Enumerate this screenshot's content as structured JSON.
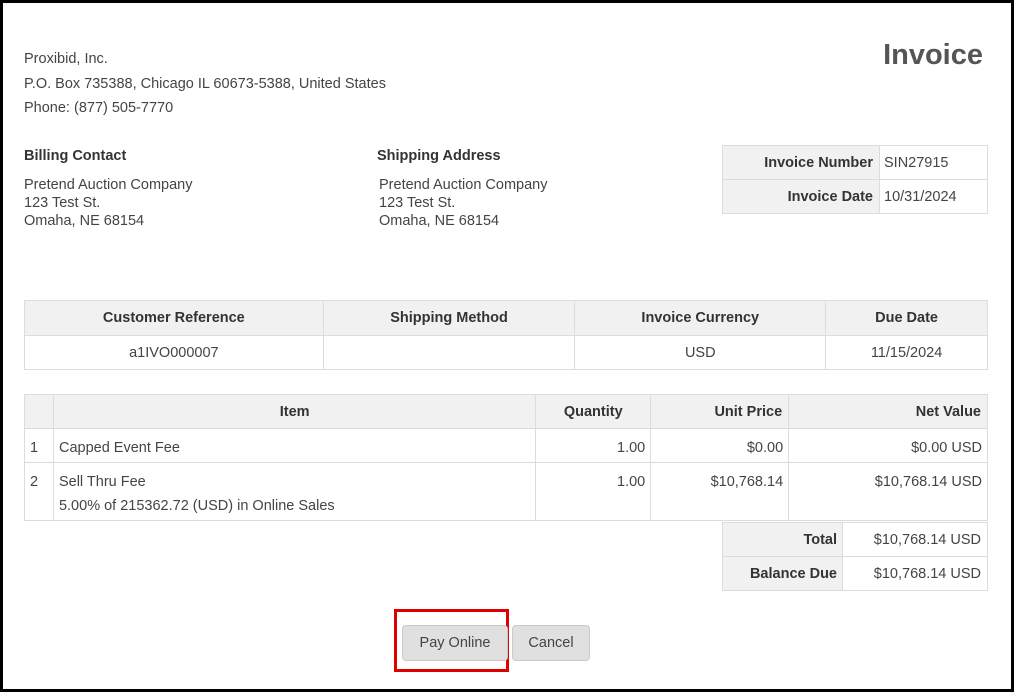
{
  "company": {
    "name": "Proxibid, Inc.",
    "address": "P.O. Box 735388, Chicago IL 60673-5388, United States",
    "phone": "Phone: (877) 505-7770"
  },
  "document_title": "Invoice",
  "billing": {
    "label": "Billing Contact",
    "lines": [
      "Pretend Auction Company",
      "123 Test St.",
      "Omaha, NE 68154"
    ]
  },
  "shipping": {
    "label": "Shipping Address",
    "lines": [
      "Pretend Auction Company",
      "123 Test St.",
      "Omaha, NE 68154"
    ]
  },
  "invoice_meta": [
    {
      "label": "Invoice Number",
      "value": "SIN27915"
    },
    {
      "label": "Invoice Date",
      "value": "10/31/2024"
    }
  ],
  "reference_table": {
    "headers": [
      "Customer Reference",
      "Shipping Method",
      "Invoice Currency",
      "Due Date"
    ],
    "row": [
      "a1IVO000007",
      "",
      "USD",
      "11/15/2024"
    ]
  },
  "items_table": {
    "headers": [
      "",
      "Item",
      "Quantity",
      "Unit Price",
      "Net Value"
    ],
    "rows": [
      {
        "index": "1",
        "item": "Capped Event Fee",
        "detail": "",
        "quantity": "1.00",
        "unit_price": "$0.00",
        "net_value": "$0.00 USD"
      },
      {
        "index": "2",
        "item": "Sell Thru Fee",
        "detail": "5.00% of 215362.72 (USD) in Online Sales",
        "quantity": "1.00",
        "unit_price": "$10,768.14",
        "net_value": "$10,768.14 USD"
      }
    ]
  },
  "totals": [
    {
      "label": "Total",
      "value": "$10,768.14 USD"
    },
    {
      "label": "Balance Due",
      "value": "$10,768.14 USD"
    }
  ],
  "buttons": {
    "pay_online": "Pay Online",
    "cancel": "Cancel"
  },
  "colors": {
    "highlight_border": "#e00000",
    "header_bg": "#f1f1f1",
    "button_bg": "#e0e0e0"
  }
}
